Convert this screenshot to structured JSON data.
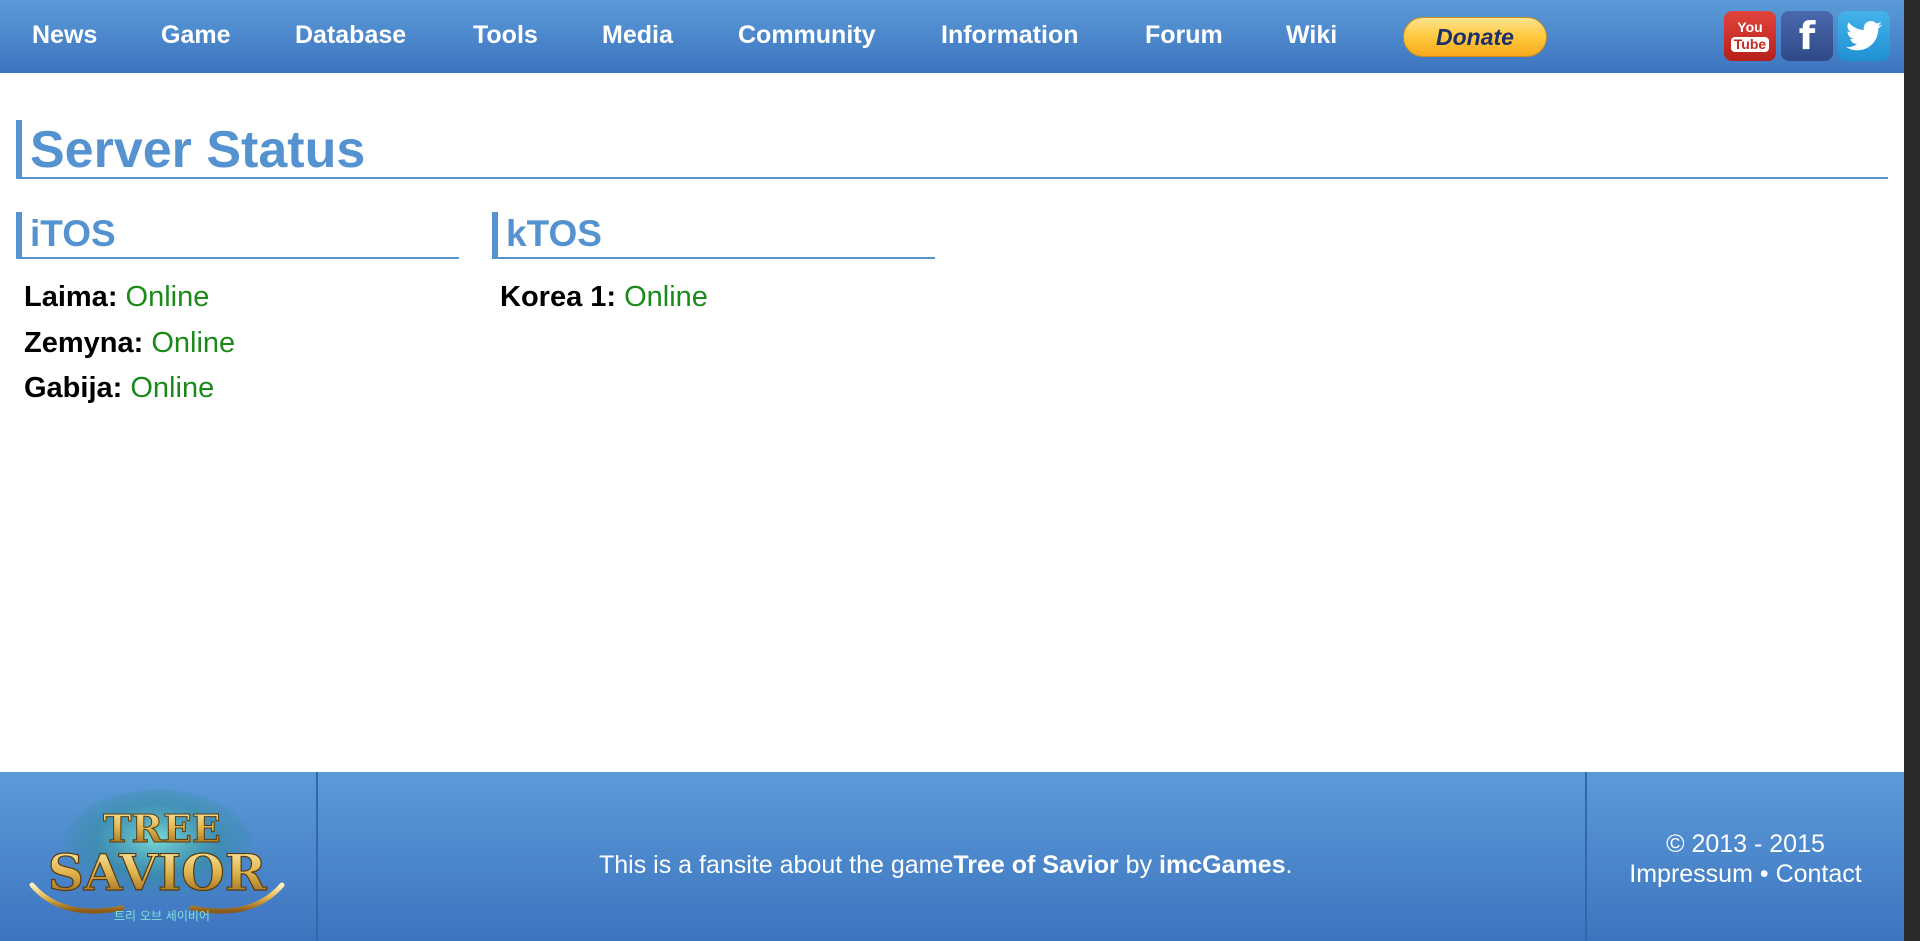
{
  "nav": {
    "items": [
      {
        "label": "News"
      },
      {
        "label": "Game"
      },
      {
        "label": "Database"
      },
      {
        "label": "Tools"
      },
      {
        "label": "Media"
      },
      {
        "label": "Community"
      },
      {
        "label": "Information"
      },
      {
        "label": "Forum"
      },
      {
        "label": "Wiki"
      }
    ],
    "donate_label": "Donate",
    "social": {
      "youtube_top": "You",
      "youtube_bottom": "Tube",
      "facebook": "f",
      "twitter_icon": "twitter-bird-icon"
    }
  },
  "main": {
    "title": "Server Status",
    "sections": [
      {
        "title": "iTOS",
        "servers": [
          {
            "name": "Laima:",
            "status": "Online"
          },
          {
            "name": "Zemyna:",
            "status": "Online"
          },
          {
            "name": "Gabija:",
            "status": "Online"
          }
        ]
      },
      {
        "title": "kTOS",
        "servers": [
          {
            "name": "Korea 1:",
            "status": "Online"
          }
        ]
      }
    ]
  },
  "footer": {
    "logo": {
      "line1": "TREE",
      "line2": "SAVIOR",
      "line3": "트리 오브 세이비어"
    },
    "text_prefix": "This is a fansite about the game",
    "game_name": "Tree of Savior",
    "by": " by ",
    "developer": "imcGames",
    "suffix": ".",
    "copyright": "© 2013 - 2015",
    "impressum": "Impressum",
    "separator": " • ",
    "contact": "Contact"
  },
  "colors": {
    "nav_bg": "#4a86cc",
    "heading": "#5592d0",
    "online": "#1a8a1a",
    "donate": "#ffcb44"
  }
}
